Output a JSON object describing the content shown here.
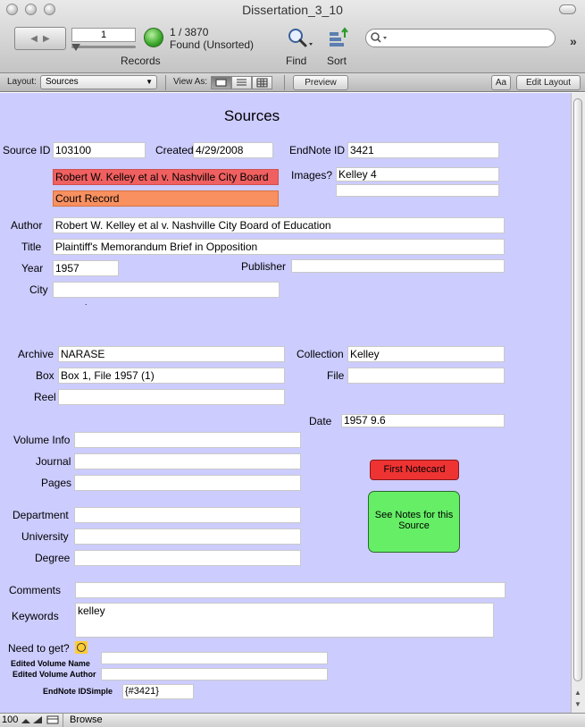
{
  "window": {
    "title": "Dissertation_3_10"
  },
  "toolbar": {
    "record_number": "1",
    "record_count": "1 / 3870",
    "found_status": "Found (Unsorted)",
    "records_label": "Records",
    "find_label": "Find",
    "sort_label": "Sort",
    "search_placeholder": "",
    "overflow": "»"
  },
  "layout_bar": {
    "layout_label": "Layout:",
    "layout_value": "Sources",
    "view_as_label": "View As:",
    "preview_label": "Preview",
    "aa_label": "Aa",
    "edit_layout_label": "Edit Layout"
  },
  "form": {
    "heading": "Sources",
    "source_id_label": "Source ID",
    "source_id": "103100",
    "created_label": "Created",
    "created": "4/29/2008",
    "endnote_id_label": "EndNote ID",
    "endnote_id": "3421",
    "source_title_highlight": "Robert W. Kelley et al v. Nashville City Board",
    "record_type": "Court Record",
    "images_label": "Images?",
    "images_value": "Kelley 4",
    "images_value_2": "",
    "author_label": "Author",
    "author": "Robert W. Kelley et al v. Nashville City Board of Education",
    "title_label": "Title",
    "title": "Plaintiff's Memorandum Brief in Opposition",
    "year_label": "Year",
    "year": "1957",
    "publisher_label": "Publisher",
    "publisher": "",
    "city_label": "City",
    "city": "",
    "stray_mark": ".",
    "archive_label": "Archive",
    "archive": "NARASE",
    "collection_label": "Collection",
    "collection": "Kelley",
    "box_label": "Box",
    "box": "Box 1, File 1957 (1)",
    "file_label": "File",
    "file": "",
    "reel_label": "Reel",
    "reel": "",
    "date_label": "Date",
    "date": "1957 9.6",
    "volume_info_label": "Volume Info",
    "volume_info": "",
    "journal_label": "Journal",
    "journal": "",
    "pages_label": "Pages",
    "pages": "",
    "department_label": "Department",
    "department": "",
    "university_label": "University",
    "university": "",
    "degree_label": "Degree",
    "degree": "",
    "first_notecard_label": "First Notecard",
    "see_notes_label_line1": "See Notes for this",
    "see_notes_label_line2": "Source",
    "comments_label": "Comments",
    "comments": "",
    "keywords_label": "Keywords",
    "keywords": "kelley",
    "need_to_get_label": "Need to get?",
    "edited_volume_name_label": "Edited Volume Name",
    "edited_volume_name": "",
    "edited_volume_author_label": "Edited Volume Author",
    "edited_volume_author": "",
    "endnote_idsimple_label": "EndNote IDSimple",
    "endnote_idsimple": "{#3421}"
  },
  "status_bar": {
    "zoom": "100",
    "mode": "Browse"
  },
  "colors": {
    "content_bg": "#ccccff",
    "highlight_red": "#f06060",
    "highlight_orange": "#f89060",
    "button_red": "#ee3333",
    "button_green": "#66ee66",
    "checkbox_yellow": "#ffcc33"
  }
}
